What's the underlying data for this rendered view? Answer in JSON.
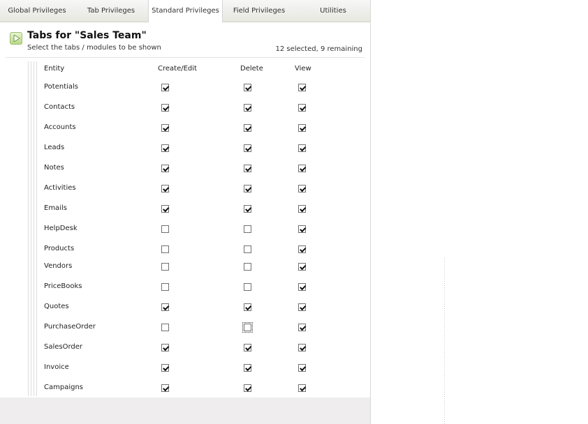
{
  "tabs": [
    {
      "label": "Global Privileges"
    },
    {
      "label": "Tab Privileges"
    },
    {
      "label": "Standard Privileges"
    },
    {
      "label": "Field Privileges"
    },
    {
      "label": "Utilities"
    }
  ],
  "active_tab": "Standard Privileges",
  "header": {
    "title": "Tabs for \"Sales Team\"",
    "subtitle": "Select the tabs / modules to be shown",
    "count": "12 selected, 9 remaining"
  },
  "columns": {
    "entity": "Entity",
    "create": "Create/Edit",
    "delete": "Delete",
    "view": "View"
  },
  "rows": [
    {
      "entity": "Potentials",
      "create": true,
      "delete": true,
      "view": true
    },
    {
      "entity": "Contacts",
      "create": true,
      "delete": true,
      "view": true
    },
    {
      "entity": "Accounts",
      "create": true,
      "delete": true,
      "view": true
    },
    {
      "entity": "Leads",
      "create": true,
      "delete": true,
      "view": true
    },
    {
      "entity": "Notes",
      "create": true,
      "delete": true,
      "view": true
    },
    {
      "entity": "Activities",
      "create": true,
      "delete": true,
      "view": true
    },
    {
      "entity": "Emails",
      "create": true,
      "delete": true,
      "view": true
    },
    {
      "entity": "HelpDesk",
      "create": false,
      "delete": false,
      "view": true
    },
    {
      "entity": "Products",
      "create": false,
      "delete": false,
      "view": true
    },
    {
      "entity": "Vendors",
      "create": false,
      "delete": false,
      "view": true
    },
    {
      "entity": "PriceBooks",
      "create": false,
      "delete": false,
      "view": true
    },
    {
      "entity": "Quotes",
      "create": true,
      "delete": true,
      "view": true
    },
    {
      "entity": "PurchaseOrder",
      "create": false,
      "delete": false,
      "view": true
    },
    {
      "entity": "SalesOrder",
      "create": true,
      "delete": true,
      "view": true
    },
    {
      "entity": "Invoice",
      "create": true,
      "delete": true,
      "view": true
    },
    {
      "entity": "Campaigns",
      "create": true,
      "delete": true,
      "view": true
    }
  ]
}
